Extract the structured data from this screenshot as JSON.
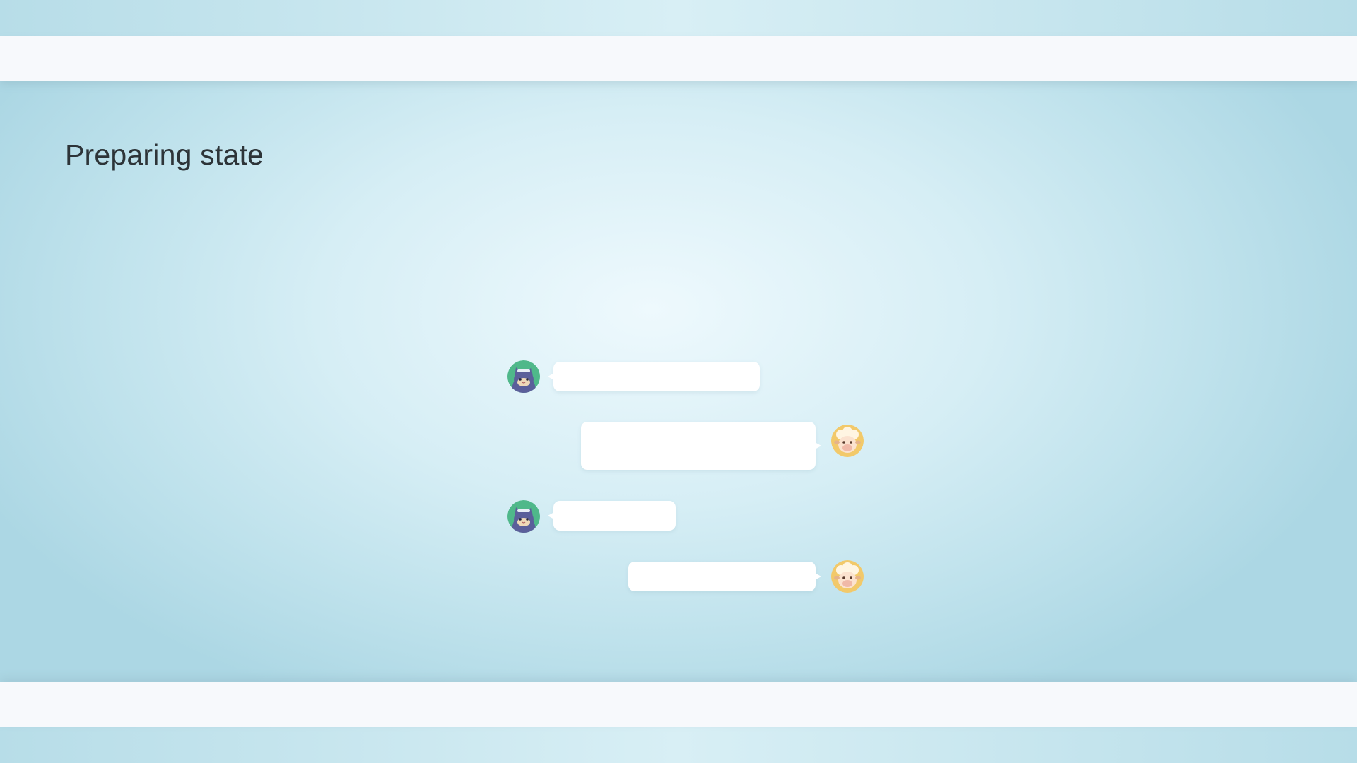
{
  "page": {
    "title": "Preparing state"
  },
  "colors": {
    "background_center": "#eef9fd",
    "background_edge": "#acd7e4",
    "bar": "#f7f9fc",
    "bubble": "#ffffff",
    "title_text": "#2d3438",
    "avatar_cat_bg": "#4fb88a",
    "avatar_cat_body": "#5b5f9a",
    "avatar_sheep_bg": "#f2c96a"
  },
  "conversation": {
    "messages": [
      {
        "sender": "cat-avatar-icon",
        "side": "left",
        "state": "placeholder"
      },
      {
        "sender": "sheep-avatar-icon",
        "side": "right",
        "state": "placeholder"
      },
      {
        "sender": "cat-avatar-icon",
        "side": "left",
        "state": "placeholder"
      },
      {
        "sender": "sheep-avatar-icon",
        "side": "right",
        "state": "placeholder"
      }
    ]
  }
}
